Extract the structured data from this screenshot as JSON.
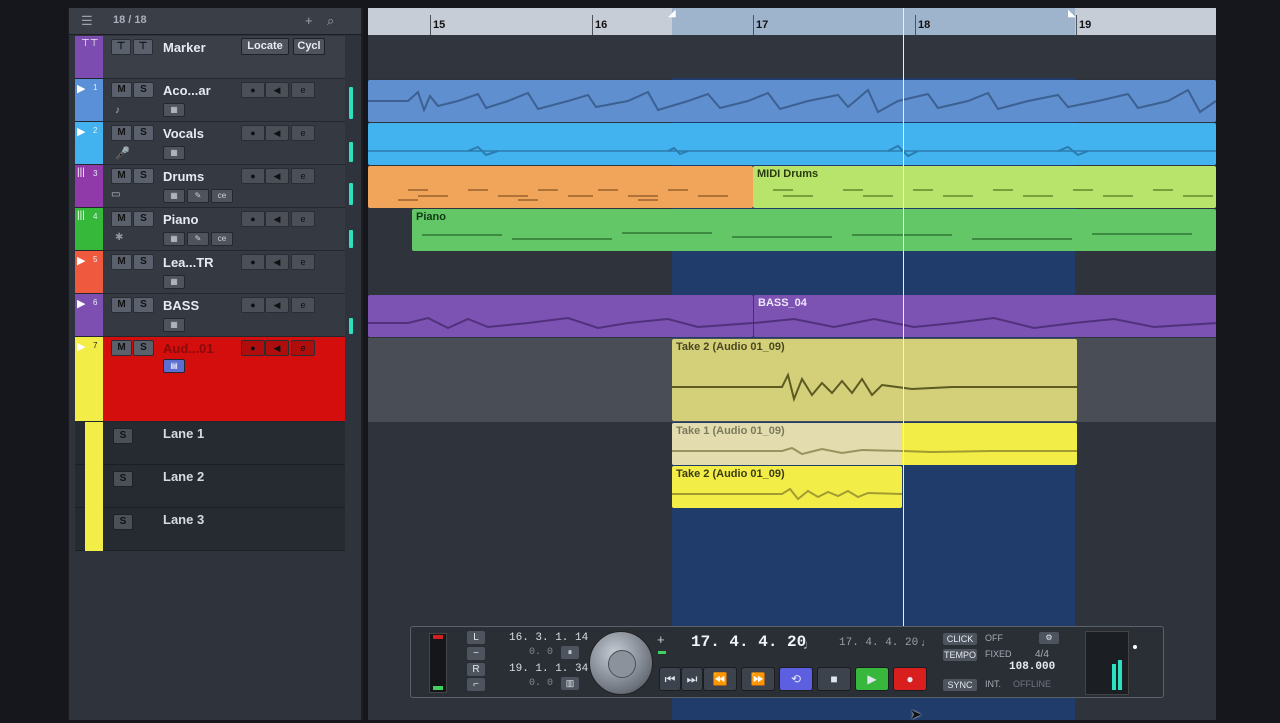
{
  "tracklist_header": {
    "count": "18 / 18"
  },
  "marker_row": {
    "name": "Marker",
    "locate": "Locate",
    "cycle": "Cycl"
  },
  "tracks": [
    {
      "num": "1",
      "name": "Aco...ar",
      "color": "#5a90d8"
    },
    {
      "num": "2",
      "name": "Vocals",
      "color": "#42b3ef"
    },
    {
      "num": "3",
      "name": "Drums",
      "color": "#8f3aa8"
    },
    {
      "num": "4",
      "name": "Piano",
      "color": "#36b83a"
    },
    {
      "num": "5",
      "name": "Lea...TR",
      "color": "#ef5a3f"
    },
    {
      "num": "6",
      "name": "BASS",
      "color": "#7c4fb0"
    },
    {
      "num": "7",
      "name": "Aud...01",
      "color": "#f3ee47"
    }
  ],
  "lanes": [
    {
      "name": "Lane 1",
      "solo": "S"
    },
    {
      "name": "Lane 2",
      "solo": "S"
    },
    {
      "name": "Lane 3",
      "solo": "S"
    }
  ],
  "buttons": {
    "mute": "M",
    "solo": "S",
    "edit": "e"
  },
  "ruler": {
    "bars": [
      "15",
      "16",
      "17",
      "18",
      "19"
    ]
  },
  "clips": {
    "midi_drums": "MIDI Drums",
    "piano": "Piano",
    "bass": "BASS_04",
    "take2_main": "Take 2 (Audio 01_09)",
    "take1": "Take 1 (Audio 01_09)",
    "take2_lane": "Take 2 (Audio 01_09)"
  },
  "transport": {
    "left_locator": "16. 3. 1. 14",
    "left_offset": "0. 0",
    "right_locator": "19. 1. 1. 34",
    "right_offset": "0. 0",
    "position_main": "17. 4. 4. 20",
    "position_secondary": "17. 4. 4. 20",
    "click_label": "CLICK",
    "click_value": "OFF",
    "tempo_label": "TEMPO",
    "tempo_mode": "FIXED",
    "signature": "4/4",
    "tempo_value": "108.000",
    "sync_label": "SYNC",
    "sync_mode": "INT.",
    "sync_status": "OFFLINE"
  }
}
